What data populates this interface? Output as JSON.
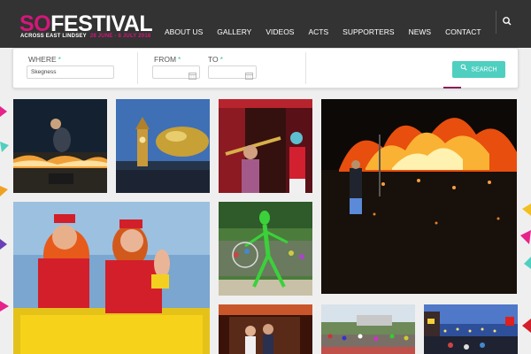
{
  "header": {
    "logo": {
      "so": "SO",
      "festival": "FESTIVAL",
      "subtitle": "ACROSS EAST LINDSEY",
      "dates": "28 JUNE - 8 JULY 2018"
    },
    "nav": [
      "ABOUT US",
      "GALLERY",
      "VIDEOS",
      "ACTS",
      "SUPPORTERS",
      "NEWS",
      "CONTACT"
    ],
    "search_icon": "search-icon"
  },
  "filters": {
    "where_label": "WHERE",
    "from_label": "FROM",
    "to_label": "TO",
    "required_mark": "*",
    "where_value": "Skegness",
    "from_value": "",
    "to_value": "",
    "calendar_icon": "calendar-icon",
    "search_label": "SEARCH"
  },
  "gallery": [
    {
      "subject": "fire-performer-leaping"
    },
    {
      "subject": "clock-tower-golden-sculpture"
    },
    {
      "subject": "trumpet-performers-red-curtain"
    },
    {
      "subject": "giant-fire-sculpture-night"
    },
    {
      "subject": "performers-in-red-on-pedalo"
    },
    {
      "subject": "green-insect-stilt-walker"
    },
    {
      "subject": "performers-on-stage"
    },
    {
      "subject": "crowd-at-seafront"
    },
    {
      "subject": "seafront-lights-dusk"
    }
  ],
  "colors": {
    "header_bg": "#333333",
    "brand_pink": "#d4177a",
    "accent_teal": "#4fcfc0",
    "page_bg": "#efefef"
  }
}
